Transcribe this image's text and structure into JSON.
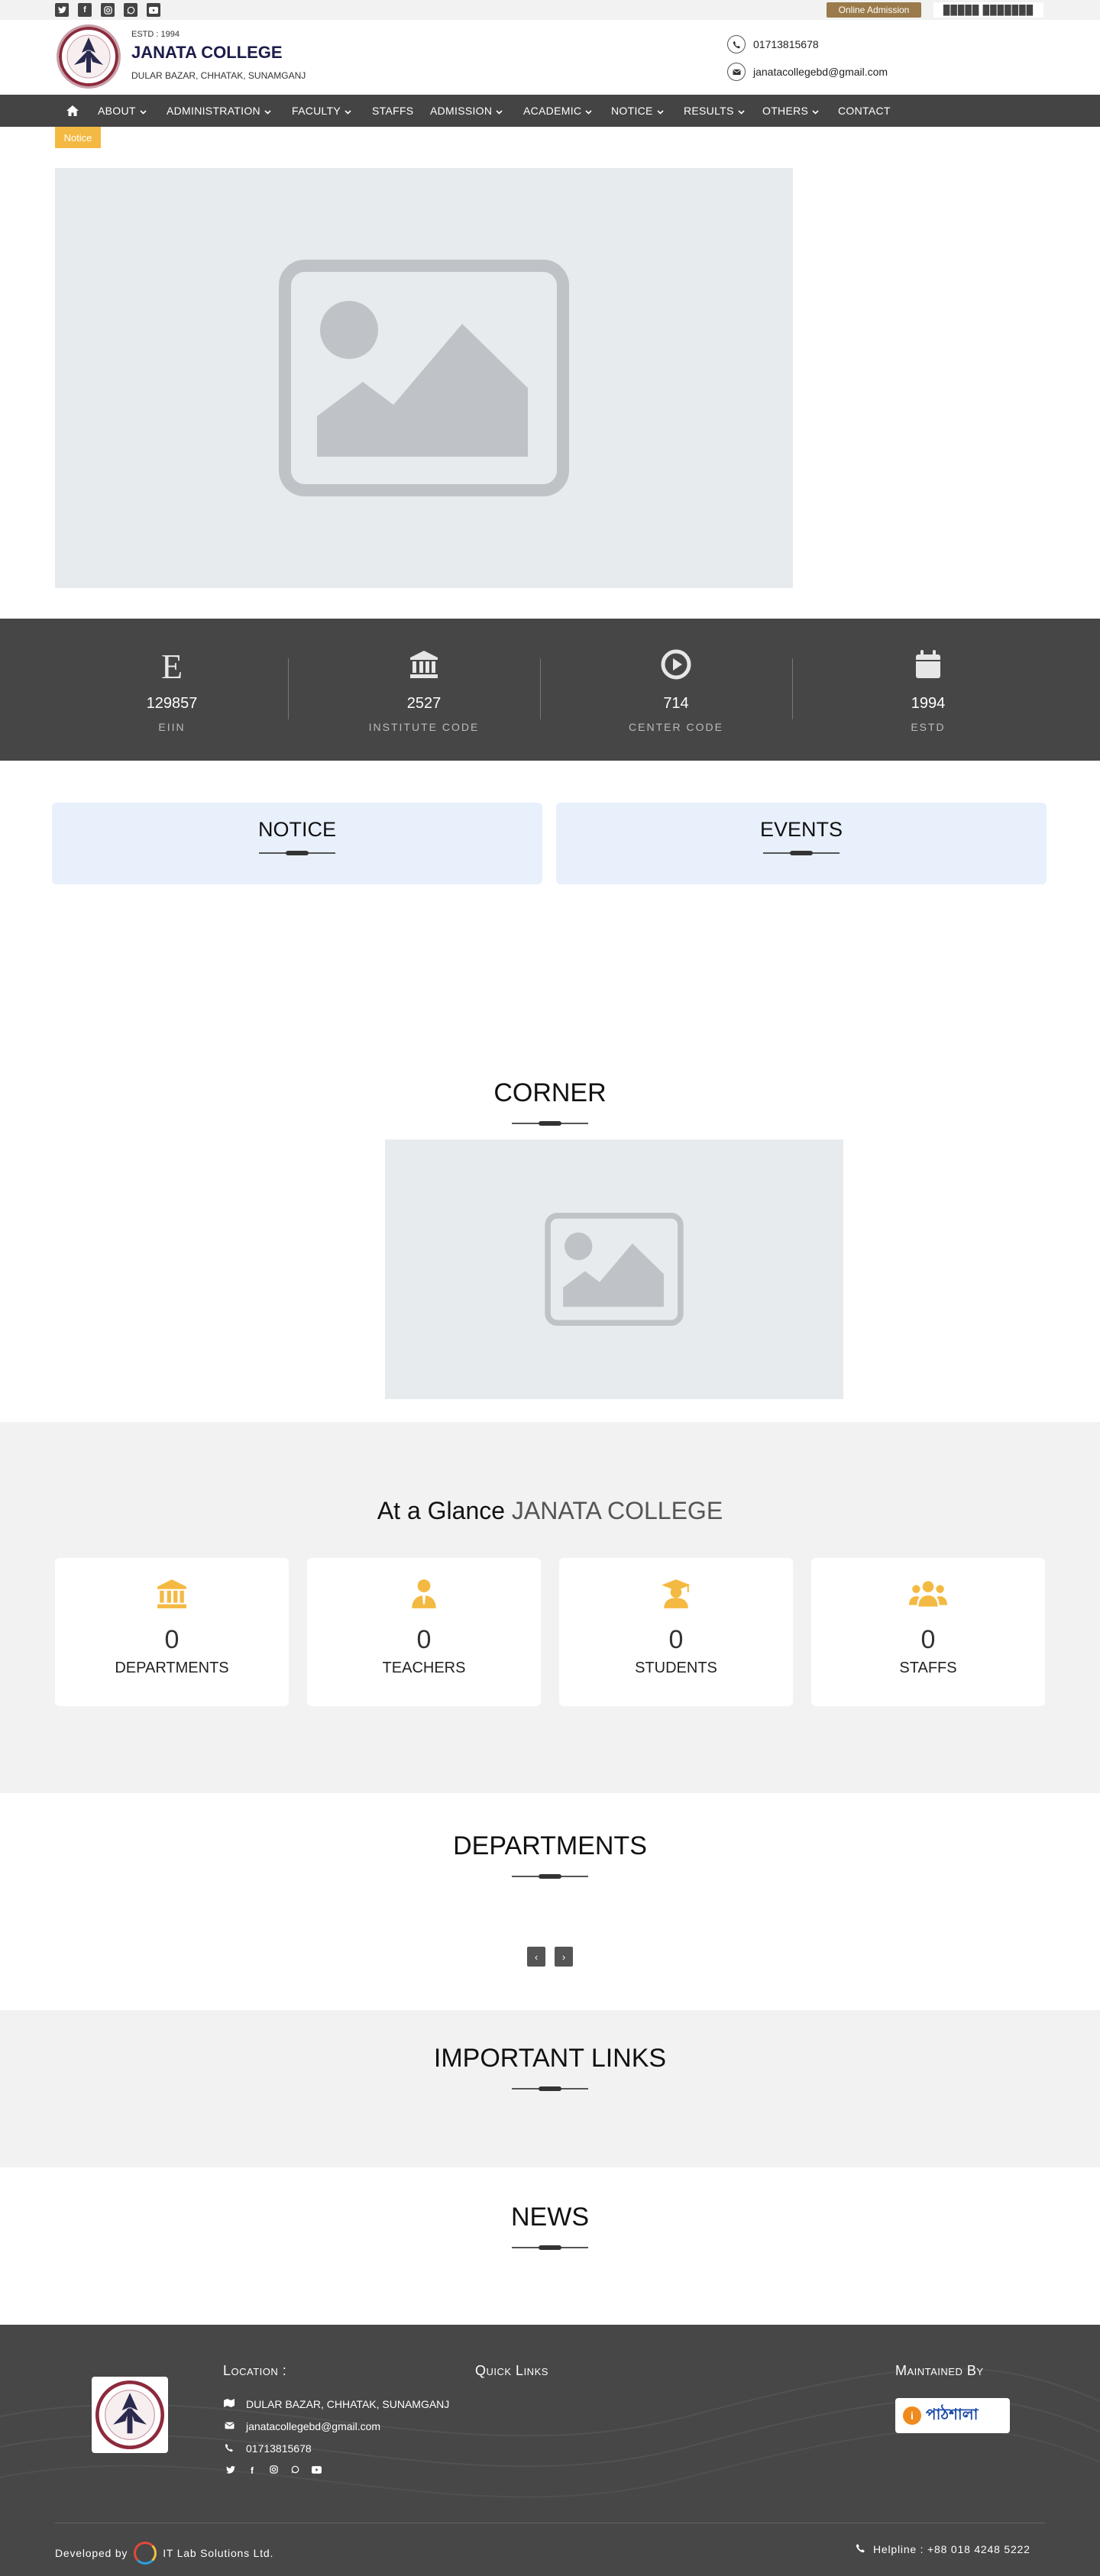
{
  "topbar": {
    "social": [
      "twitter-icon",
      "facebook-icon",
      "instagram-icon",
      "whatsapp-icon",
      "youtube-icon"
    ],
    "online_admission": "Online Admission",
    "language": "█████ ███████"
  },
  "header": {
    "estd": "ESTD : 1994",
    "name": "JANATA COLLEGE",
    "address": "DULAR BAZAR, CHHATAK, SUNAMGANJ",
    "phone": "01713815678",
    "email": "janatacollegebd@gmail.com"
  },
  "nav": {
    "items": [
      {
        "label": "ABOUT",
        "dropdown": true
      },
      {
        "label": "ADMINISTRATION",
        "dropdown": true
      },
      {
        "label": "FACULTY",
        "dropdown": true
      },
      {
        "label": "STAFFS",
        "dropdown": false
      },
      {
        "label": "ADMISSION",
        "dropdown": true
      },
      {
        "label": "ACADEMIC",
        "dropdown": true
      },
      {
        "label": "NOTICE",
        "dropdown": true
      },
      {
        "label": "RESULTS",
        "dropdown": true
      },
      {
        "label": "OTHERS",
        "dropdown": true
      },
      {
        "label": "CONTACT",
        "dropdown": false
      }
    ]
  },
  "notice_tag": "Notice",
  "stats": [
    {
      "icon": "letter-e-icon",
      "value": "129857",
      "label": "EIIN"
    },
    {
      "icon": "institution-icon",
      "value": "2527",
      "label": "INSTITUTE CODE"
    },
    {
      "icon": "play-circle-icon",
      "value": "714",
      "label": "CENTER CODE"
    },
    {
      "icon": "calendar-icon",
      "value": "1994",
      "label": "ESTD"
    }
  ],
  "panels": {
    "notice": "NOTICE",
    "events": "EVENTS"
  },
  "corner": {
    "title": "CORNER"
  },
  "glance": {
    "title_prefix": "At a Glance",
    "title_name": "JANATA COLLEGE",
    "cards": [
      {
        "icon": "institution-icon",
        "value": "0",
        "label": "DEPARTMENTS"
      },
      {
        "icon": "teacher-icon",
        "value": "0",
        "label": "TEACHERS"
      },
      {
        "icon": "graduate-icon",
        "value": "0",
        "label": "STUDENTS"
      },
      {
        "icon": "users-icon",
        "value": "0",
        "label": "STAFFS"
      }
    ],
    "accent": "#f4b942"
  },
  "departments": {
    "title": "DEPARTMENTS",
    "prev": "‹",
    "next": "›"
  },
  "important_links": {
    "title": "IMPORTANT LINKS"
  },
  "news": {
    "title": "NEWS"
  },
  "footer": {
    "location_title": "Location :",
    "address": "DULAR BAZAR, CHHATAK, SUNAMGANJ",
    "email": "janatacollegebd@gmail.com",
    "phone": "01713815678",
    "quick_links_title": "Quick Links",
    "maintained_title": "Maintained By",
    "maintainer_logo": "পাঠশালা",
    "developed_by": "Developed by",
    "developer": "IT Lab Solutions Ltd.",
    "helpline": "Helpline : +88 018 4248 5222"
  },
  "colors": {
    "dark": "#444444",
    "accent": "#f4b942",
    "online_btn": "#9b7b4b",
    "panel": "#e8f0fc"
  }
}
